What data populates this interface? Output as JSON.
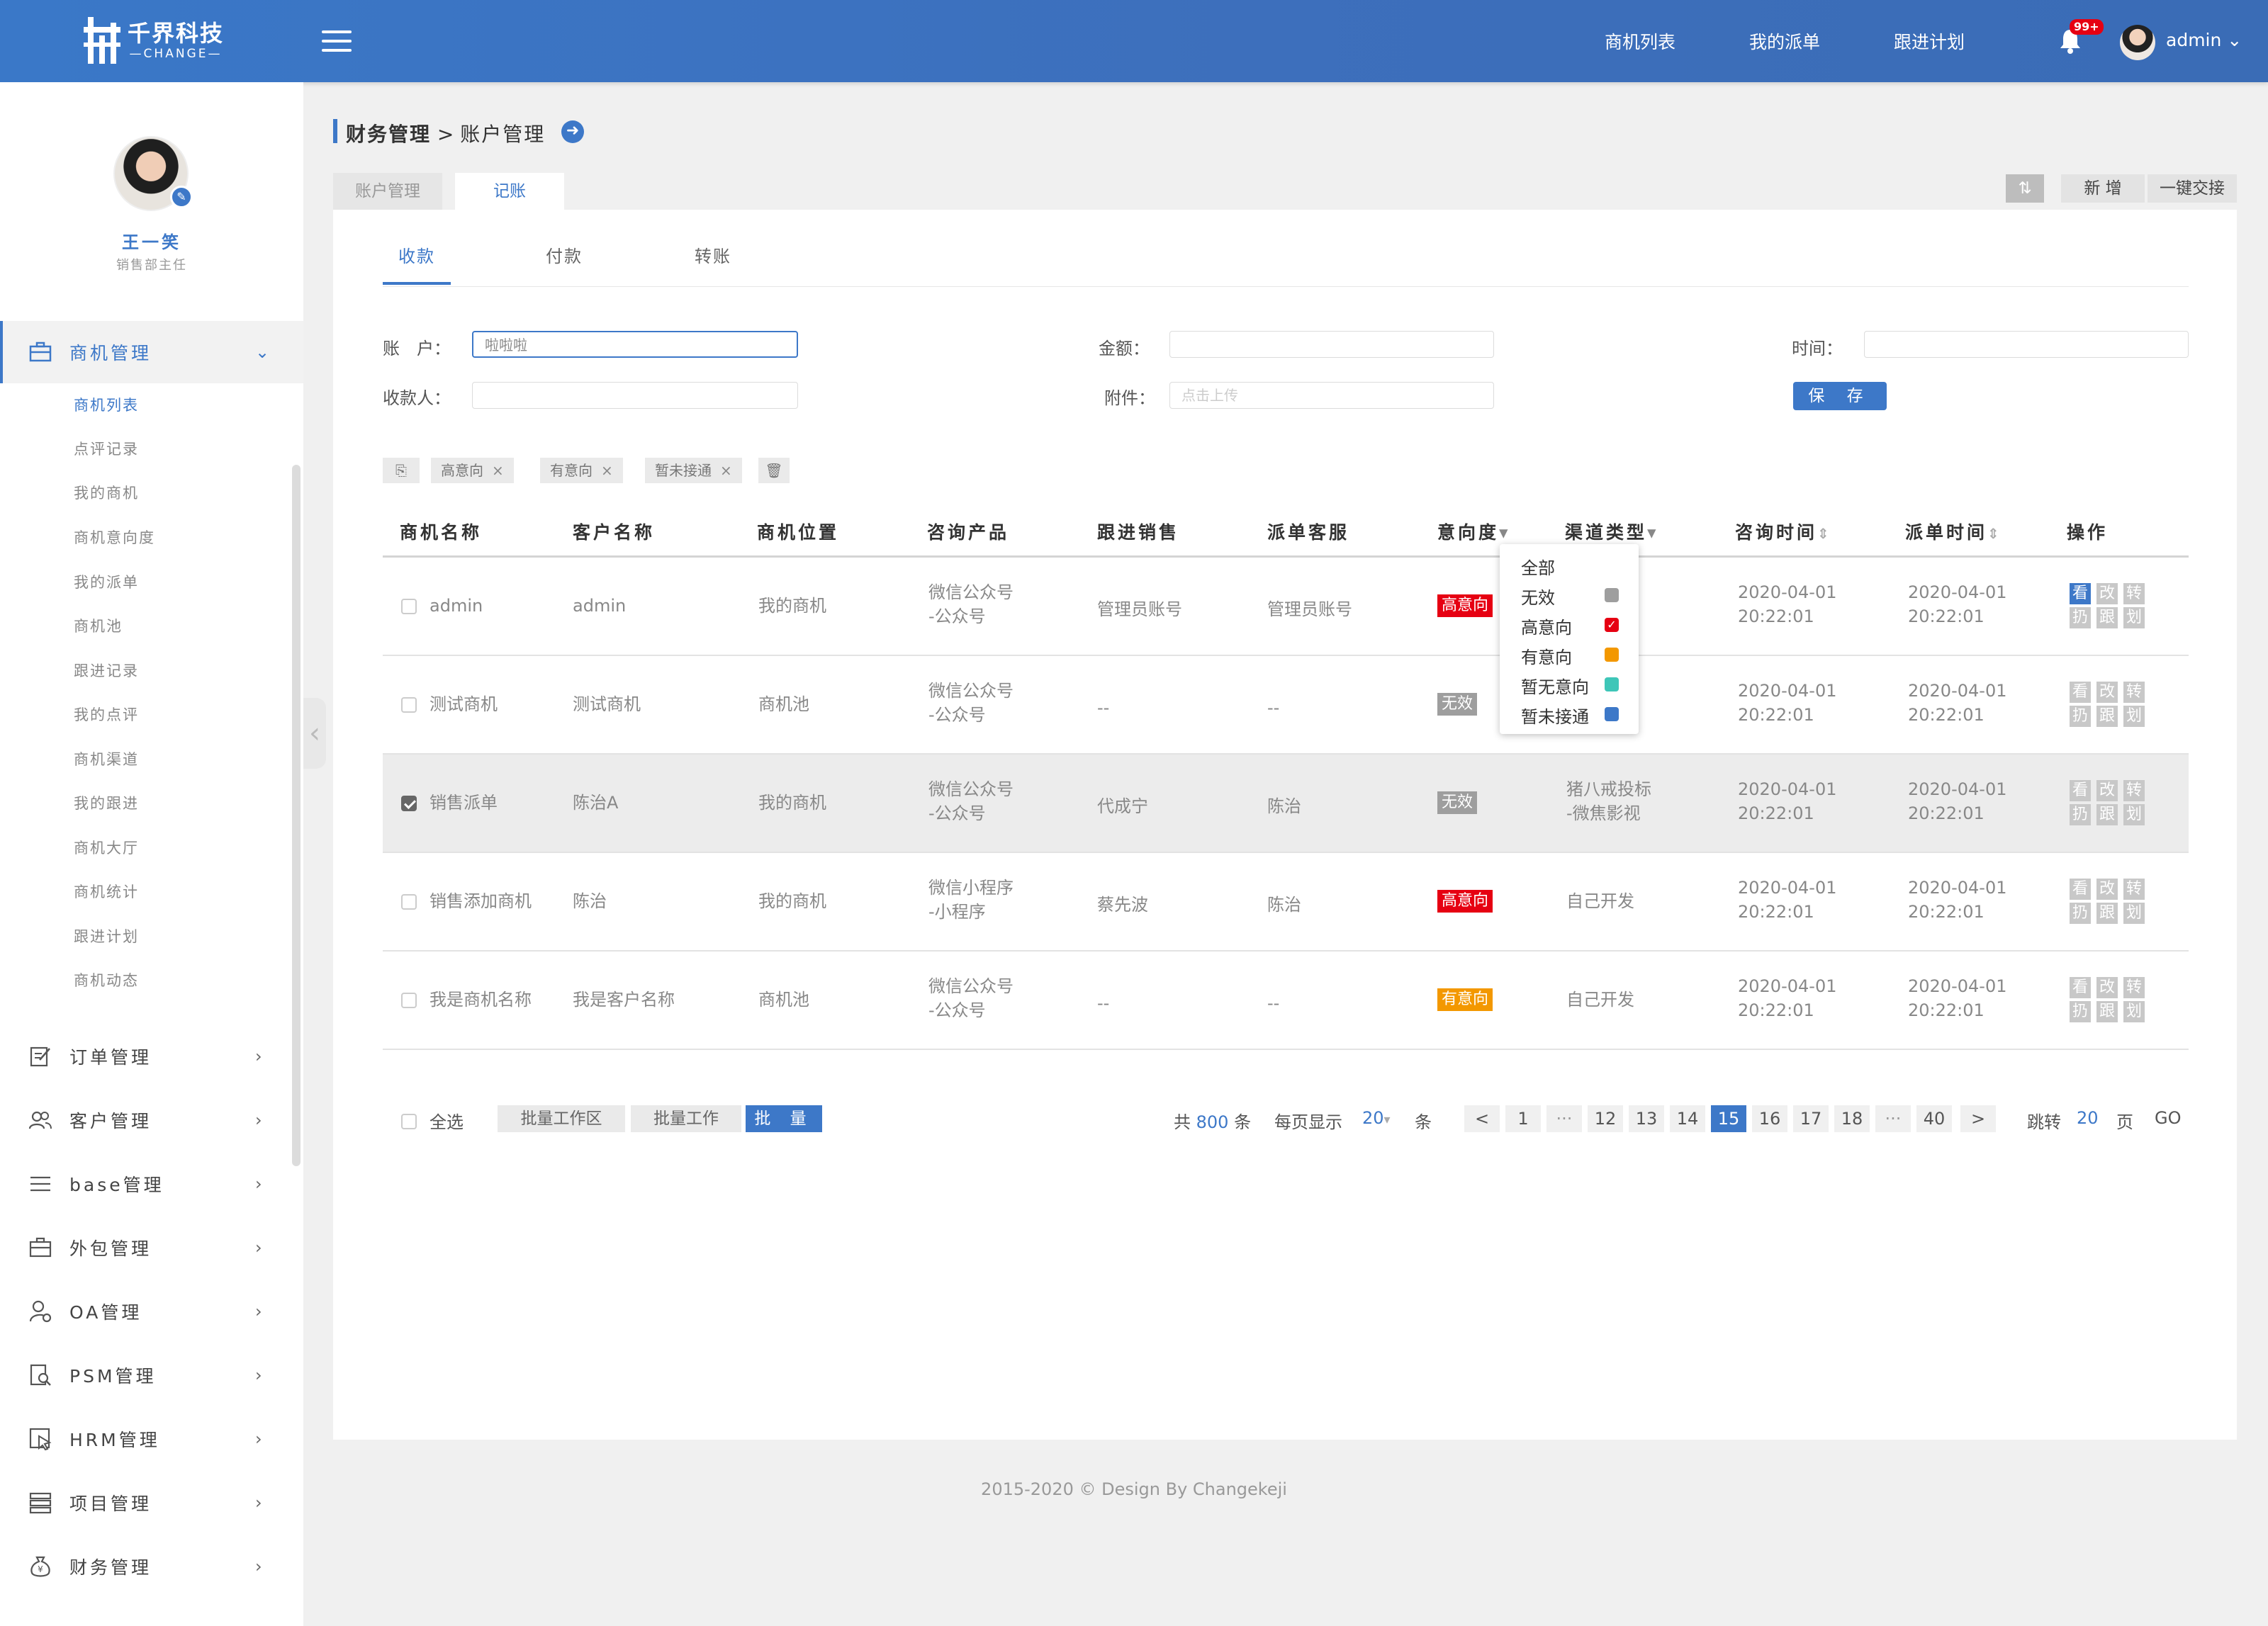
{
  "header": {
    "logo_cn": "千界科技",
    "logo_en": "CHANGE",
    "nav": [
      "商机列表",
      "我的派单",
      "跟进计划"
    ],
    "notification_badge": "99+",
    "user": "admin"
  },
  "profile": {
    "name": "王一笑",
    "role": "销售部主任"
  },
  "menu": {
    "active": {
      "label": "商机管理",
      "sub_items": [
        "商机列表",
        "点评记录",
        "我的商机",
        "商机意向度",
        "我的派单",
        "商机池",
        "跟进记录",
        "我的点评",
        "商机渠道",
        "我的跟进",
        "商机大厅",
        "商机统计",
        "跟进计划",
        "商机动态"
      ]
    },
    "items": [
      {
        "label": "订单管理",
        "icon": "edit-icon"
      },
      {
        "label": "客户管理",
        "icon": "users-icon"
      },
      {
        "label": "base管理",
        "icon": "list-icon"
      },
      {
        "label": "外包管理",
        "icon": "briefcase-icon"
      },
      {
        "label": "OA管理",
        "icon": "user-settings-icon"
      },
      {
        "label": "PSM管理",
        "icon": "document-search-icon"
      },
      {
        "label": "HRM管理",
        "icon": "pointer-icon"
      },
      {
        "label": "项目管理",
        "icon": "stack-icon"
      },
      {
        "label": "财务管理",
        "icon": "money-bag-icon"
      }
    ]
  },
  "breadcrumb": {
    "parent": "财务管理",
    "separator": ">",
    "current": "账户管理"
  },
  "page_tabs": [
    "账户管理",
    "记账"
  ],
  "toolbar": {
    "add": "新 增",
    "handover": "一键交接"
  },
  "sub_tabs": [
    "收款",
    "付款",
    "转账"
  ],
  "form": {
    "account_label": "账　户：",
    "account_value": "啦啦啦",
    "amount_label": "金额：",
    "time_label": "时间：",
    "payee_label": "收款人：",
    "attachment_label": "附件：",
    "attachment_placeholder": "点击上传",
    "save": "保 存"
  },
  "filter_tags": [
    "高意向",
    "有意向",
    "暂未接通"
  ],
  "table": {
    "columns": [
      "商机名称",
      "客户名称",
      "商机位置",
      "咨询产品",
      "跟进销售",
      "派单客服",
      "意向度",
      "渠道类型",
      "咨询时间",
      "派单时间",
      "操作"
    ],
    "rows": [
      {
        "name": "admin",
        "customer": "admin",
        "location": "我的商机",
        "product1": "微信公众号",
        "product2": "-公众号",
        "sales": "管理员账号",
        "service": "管理员账号",
        "intent": "高意向",
        "channel1": "",
        "channel2": "",
        "consult1": "2020-04-01",
        "consult2": "20:22:01",
        "dispatch1": "2020-04-01",
        "dispatch2": "20:22:01",
        "checked": false
      },
      {
        "name": "测试商机",
        "customer": "测试商机",
        "location": "商机池",
        "product1": "微信公众号",
        "product2": "-公众号",
        "sales": "--",
        "service": "--",
        "intent": "无效",
        "channel1": "",
        "channel2": "",
        "consult1": "2020-04-01",
        "consult2": "20:22:01",
        "dispatch1": "2020-04-01",
        "dispatch2": "20:22:01",
        "checked": false
      },
      {
        "name": "销售派单",
        "customer": "陈治A",
        "location": "我的商机",
        "product1": "微信公众号",
        "product2": "-公众号",
        "sales": "代成宁",
        "service": "陈治",
        "intent": "无效",
        "channel1": "猪八戒投标",
        "channel2": "-微焦影视",
        "consult1": "2020-04-01",
        "consult2": "20:22:01",
        "dispatch1": "2020-04-01",
        "dispatch2": "20:22:01",
        "checked": true
      },
      {
        "name": "销售添加商机",
        "customer": "陈治",
        "location": "我的商机",
        "product1": "微信小程序",
        "product2": "-小程序",
        "sales": "蔡先波",
        "service": "陈治",
        "intent": "高意向",
        "channel1": "自己开发",
        "channel2": "",
        "consult1": "2020-04-01",
        "consult2": "20:22:01",
        "dispatch1": "2020-04-01",
        "dispatch2": "20:22:01",
        "checked": false
      },
      {
        "name": "我是商机名称",
        "customer": "我是客户名称",
        "location": "商机池",
        "product1": "微信公众号",
        "product2": "-公众号",
        "sales": "--",
        "service": "--",
        "intent": "有意向",
        "channel1": "自己开发",
        "channel2": "",
        "consult1": "2020-04-01",
        "consult2": "20:22:01",
        "dispatch1": "2020-04-01",
        "dispatch2": "20:22:01",
        "checked": false
      }
    ],
    "ops": [
      "看",
      "改",
      "转",
      "扔",
      "跟",
      "划"
    ]
  },
  "intent_dropdown": [
    {
      "label": "全部",
      "color": ""
    },
    {
      "label": "无效",
      "color": "#9e9e9e"
    },
    {
      "label": "高意向",
      "color": "#e60012"
    },
    {
      "label": "有意向",
      "color": "#f39800"
    },
    {
      "label": "暂无意向",
      "color": "#3ec6b8"
    },
    {
      "label": "暂未接通",
      "color": "#3d78c8"
    }
  ],
  "colors": {
    "accent": "#3d78c8",
    "high": "#e60012",
    "medium": "#f39800",
    "invalid": "#9e9e9e"
  },
  "footer": {
    "select_all": "全选",
    "batch_area": "批量工作区",
    "batch_work": "批量工作",
    "batch": "批 量",
    "total_prefix": "共",
    "total": "800",
    "total_suffix": "条",
    "per_page_prefix": "每页显示",
    "per_page": "20",
    "per_page_suffix": "条",
    "prev": "<",
    "next": ">",
    "ellipsis": "···",
    "pages": [
      "1",
      "12",
      "13",
      "14",
      "15",
      "16",
      "17",
      "18",
      "40"
    ],
    "current_page": "15",
    "jump_prefix": "跳转",
    "jump_value": "20",
    "jump_suffix": "页",
    "go": "GO"
  },
  "copyright": "2015-2020 © Design By Changekeji"
}
